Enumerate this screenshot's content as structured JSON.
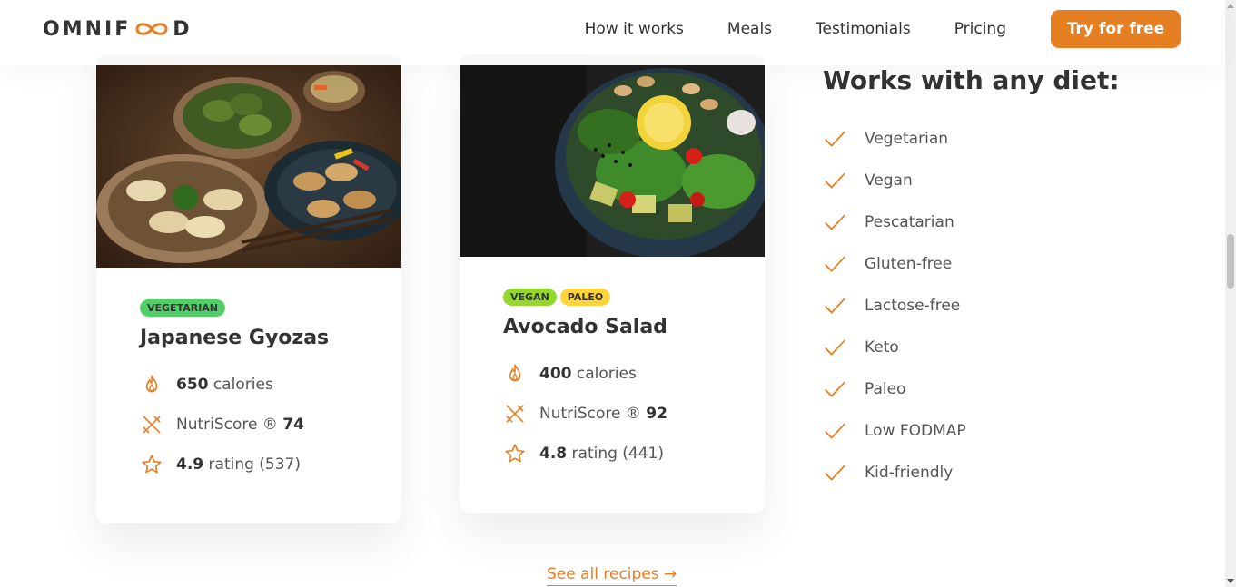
{
  "header": {
    "logo_left": "OMNIF",
    "logo_right": "D",
    "nav": [
      "How it works",
      "Meals",
      "Testimonials",
      "Pricing"
    ],
    "cta": "Try for free"
  },
  "meals": [
    {
      "tags": [
        "Vegetarian"
      ],
      "title": "Japanese Gyozas",
      "calories_value": "650",
      "calories_label": "calories",
      "nutri_label": "NutriScore ®",
      "nutri_value": "74",
      "rating_value": "4.9",
      "rating_label": "rating (537)"
    },
    {
      "tags": [
        "Vegan",
        "Paleo"
      ],
      "title": "Avocado Salad",
      "calories_value": "400",
      "calories_label": "calories",
      "nutri_label": "NutriScore ®",
      "nutri_value": "92",
      "rating_value": "4.8",
      "rating_label": "rating (441)"
    }
  ],
  "diets": {
    "title": "Works with any diet:",
    "items": [
      "Vegetarian",
      "Vegan",
      "Pescatarian",
      "Gluten-free",
      "Lactose-free",
      "Keto",
      "Paleo",
      "Low FODMAP",
      "Kid-friendly"
    ]
  },
  "see_all": "See all recipes →",
  "colors": {
    "accent": "#e67e22",
    "vegetarian": "#51cf66",
    "vegan": "#94d82d",
    "paleo": "#ffd43b"
  }
}
